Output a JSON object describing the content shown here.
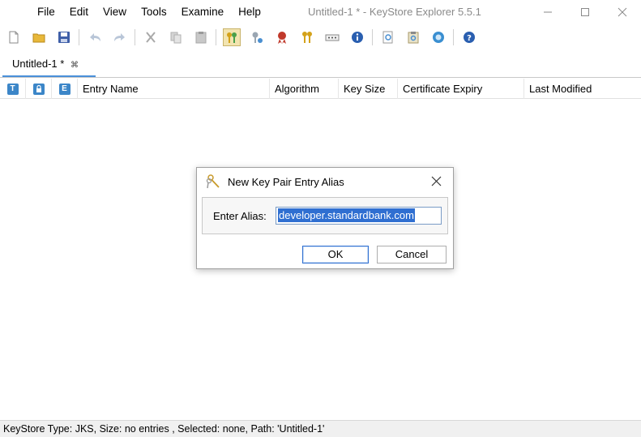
{
  "menu": {
    "items": [
      "File",
      "Edit",
      "View",
      "Tools",
      "Examine",
      "Help"
    ]
  },
  "window": {
    "title": "Untitled-1 * - KeyStore Explorer 5.5.1"
  },
  "toolbar": {
    "icons": [
      "new-icon",
      "open-icon",
      "save-icon",
      "undo-icon",
      "redo-icon",
      "cut-icon",
      "copy-icon",
      "paste-icon",
      "generate-key-pair-icon",
      "generate-secret-key-icon",
      "import-trusted-cert-icon",
      "import-key-pair-icon",
      "set-password-icon",
      "properties-icon",
      "examine-file-icon",
      "examine-clipboard-icon",
      "examine-ssl-icon",
      "help-icon"
    ]
  },
  "tab": {
    "label": "Untitled-1 *",
    "close_glyph": "⌘"
  },
  "table": {
    "icon_columns": [
      "T",
      "",
      "E"
    ],
    "columns": [
      "Entry Name",
      "Algorithm",
      "Key Size",
      "Certificate Expiry",
      "Last Modified"
    ]
  },
  "dialog": {
    "title": "New Key Pair Entry Alias",
    "label": "Enter Alias:",
    "value": "developer.standardbank.com",
    "ok_label": "OK",
    "cancel_label": "Cancel"
  },
  "status": {
    "text": "KeyStore Type: JKS, Size: no entries , Selected: none, Path: 'Untitled-1'"
  },
  "colors": {
    "accent": "#3c86c8",
    "selection": "#2f6fd1"
  }
}
